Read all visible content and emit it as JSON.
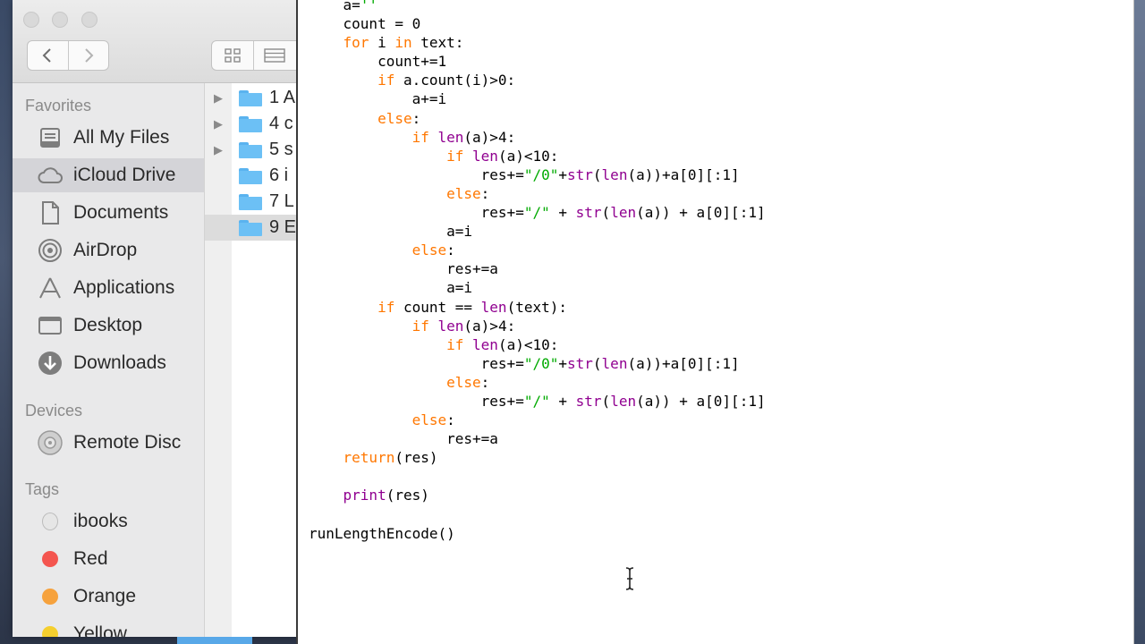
{
  "finder": {
    "sidebar": {
      "favorites_title": "Favorites",
      "favorites": [
        {
          "label": "All My Files",
          "icon": "all-files-icon"
        },
        {
          "label": "iCloud Drive",
          "icon": "cloud-icon",
          "selected": true
        },
        {
          "label": "Documents",
          "icon": "documents-icon"
        },
        {
          "label": "AirDrop",
          "icon": "airdrop-icon"
        },
        {
          "label": "Applications",
          "icon": "applications-icon"
        },
        {
          "label": "Desktop",
          "icon": "desktop-icon"
        },
        {
          "label": "Downloads",
          "icon": "download-icon"
        }
      ],
      "devices_title": "Devices",
      "devices": [
        {
          "label": "Remote Disc",
          "icon": "disc-icon"
        }
      ],
      "tags_title": "Tags",
      "tags": [
        {
          "label": "ibooks",
          "color": "#e0e0e0"
        },
        {
          "label": "Red",
          "color": "#f4554f"
        },
        {
          "label": "Orange",
          "color": "#f6a23d"
        },
        {
          "label": "Yellow",
          "color": "#f5cf2e"
        }
      ]
    },
    "files": [
      {
        "name": "1 A"
      },
      {
        "name": "4 c"
      },
      {
        "name": "5 s"
      },
      {
        "name": "6 i"
      },
      {
        "name": "7 L"
      },
      {
        "name": "9 E",
        "selected": true
      }
    ]
  },
  "editor": {
    "lines": [
      [
        {
          "t": "    a=",
          "c": ""
        },
        {
          "t": "''",
          "c": "st"
        }
      ],
      [
        {
          "t": "    count = 0",
          "c": ""
        }
      ],
      [
        {
          "t": "    ",
          "c": ""
        },
        {
          "t": "for",
          "c": "kw"
        },
        {
          "t": " i ",
          "c": ""
        },
        {
          "t": "in",
          "c": "kw"
        },
        {
          "t": " text:",
          "c": ""
        }
      ],
      [
        {
          "t": "        count+=1",
          "c": ""
        }
      ],
      [
        {
          "t": "        ",
          "c": ""
        },
        {
          "t": "if",
          "c": "kw"
        },
        {
          "t": " a.count(i)>0:",
          "c": ""
        }
      ],
      [
        {
          "t": "            a+=i",
          "c": ""
        }
      ],
      [
        {
          "t": "        ",
          "c": ""
        },
        {
          "t": "else",
          "c": "kw"
        },
        {
          "t": ":",
          "c": ""
        }
      ],
      [
        {
          "t": "            ",
          "c": ""
        },
        {
          "t": "if",
          "c": "kw"
        },
        {
          "t": " ",
          "c": ""
        },
        {
          "t": "len",
          "c": "bi"
        },
        {
          "t": "(a)>4:",
          "c": ""
        }
      ],
      [
        {
          "t": "                ",
          "c": ""
        },
        {
          "t": "if",
          "c": "kw"
        },
        {
          "t": " ",
          "c": ""
        },
        {
          "t": "len",
          "c": "bi"
        },
        {
          "t": "(a)<10:",
          "c": ""
        }
      ],
      [
        {
          "t": "                    res+=",
          "c": ""
        },
        {
          "t": "\"/0\"",
          "c": "st"
        },
        {
          "t": "+",
          "c": ""
        },
        {
          "t": "str",
          "c": "bi"
        },
        {
          "t": "(",
          "c": ""
        },
        {
          "t": "len",
          "c": "bi"
        },
        {
          "t": "(a))+a[0][:1]",
          "c": ""
        }
      ],
      [
        {
          "t": "                ",
          "c": ""
        },
        {
          "t": "else",
          "c": "kw"
        },
        {
          "t": ":",
          "c": ""
        }
      ],
      [
        {
          "t": "                    res+=",
          "c": ""
        },
        {
          "t": "\"/\"",
          "c": "st"
        },
        {
          "t": " + ",
          "c": ""
        },
        {
          "t": "str",
          "c": "bi"
        },
        {
          "t": "(",
          "c": ""
        },
        {
          "t": "len",
          "c": "bi"
        },
        {
          "t": "(a)) + a[0][:1]",
          "c": ""
        }
      ],
      [
        {
          "t": "                a=i",
          "c": ""
        }
      ],
      [
        {
          "t": "            ",
          "c": ""
        },
        {
          "t": "else",
          "c": "kw"
        },
        {
          "t": ":",
          "c": ""
        }
      ],
      [
        {
          "t": "                res+=a",
          "c": ""
        }
      ],
      [
        {
          "t": "                a=i",
          "c": ""
        }
      ],
      [
        {
          "t": "        ",
          "c": ""
        },
        {
          "t": "if",
          "c": "kw"
        },
        {
          "t": " count == ",
          "c": ""
        },
        {
          "t": "len",
          "c": "bi"
        },
        {
          "t": "(text):",
          "c": ""
        }
      ],
      [
        {
          "t": "            ",
          "c": ""
        },
        {
          "t": "if",
          "c": "kw"
        },
        {
          "t": " ",
          "c": ""
        },
        {
          "t": "len",
          "c": "bi"
        },
        {
          "t": "(a)>4:",
          "c": ""
        }
      ],
      [
        {
          "t": "                ",
          "c": ""
        },
        {
          "t": "if",
          "c": "kw"
        },
        {
          "t": " ",
          "c": ""
        },
        {
          "t": "len",
          "c": "bi"
        },
        {
          "t": "(a)<10:",
          "c": ""
        }
      ],
      [
        {
          "t": "                    res+=",
          "c": ""
        },
        {
          "t": "\"/0\"",
          "c": "st"
        },
        {
          "t": "+",
          "c": ""
        },
        {
          "t": "str",
          "c": "bi"
        },
        {
          "t": "(",
          "c": ""
        },
        {
          "t": "len",
          "c": "bi"
        },
        {
          "t": "(a))+a[0][:1]",
          "c": ""
        }
      ],
      [
        {
          "t": "                ",
          "c": ""
        },
        {
          "t": "else",
          "c": "kw"
        },
        {
          "t": ":",
          "c": ""
        }
      ],
      [
        {
          "t": "                    res+=",
          "c": ""
        },
        {
          "t": "\"/\"",
          "c": "st"
        },
        {
          "t": " + ",
          "c": ""
        },
        {
          "t": "str",
          "c": "bi"
        },
        {
          "t": "(",
          "c": ""
        },
        {
          "t": "len",
          "c": "bi"
        },
        {
          "t": "(a)) + a[0][:1]",
          "c": ""
        }
      ],
      [
        {
          "t": "            ",
          "c": ""
        },
        {
          "t": "else",
          "c": "kw"
        },
        {
          "t": ":",
          "c": ""
        }
      ],
      [
        {
          "t": "                res+=a",
          "c": ""
        }
      ],
      [
        {
          "t": "    ",
          "c": ""
        },
        {
          "t": "return",
          "c": "kw"
        },
        {
          "t": "(res)",
          "c": ""
        }
      ],
      [
        {
          "t": "",
          "c": ""
        }
      ],
      [
        {
          "t": "    ",
          "c": ""
        },
        {
          "t": "print",
          "c": "bi"
        },
        {
          "t": "(res)",
          "c": ""
        }
      ],
      [
        {
          "t": "",
          "c": ""
        }
      ],
      [
        {
          "t": "runLengthEncode()",
          "c": ""
        }
      ]
    ]
  }
}
